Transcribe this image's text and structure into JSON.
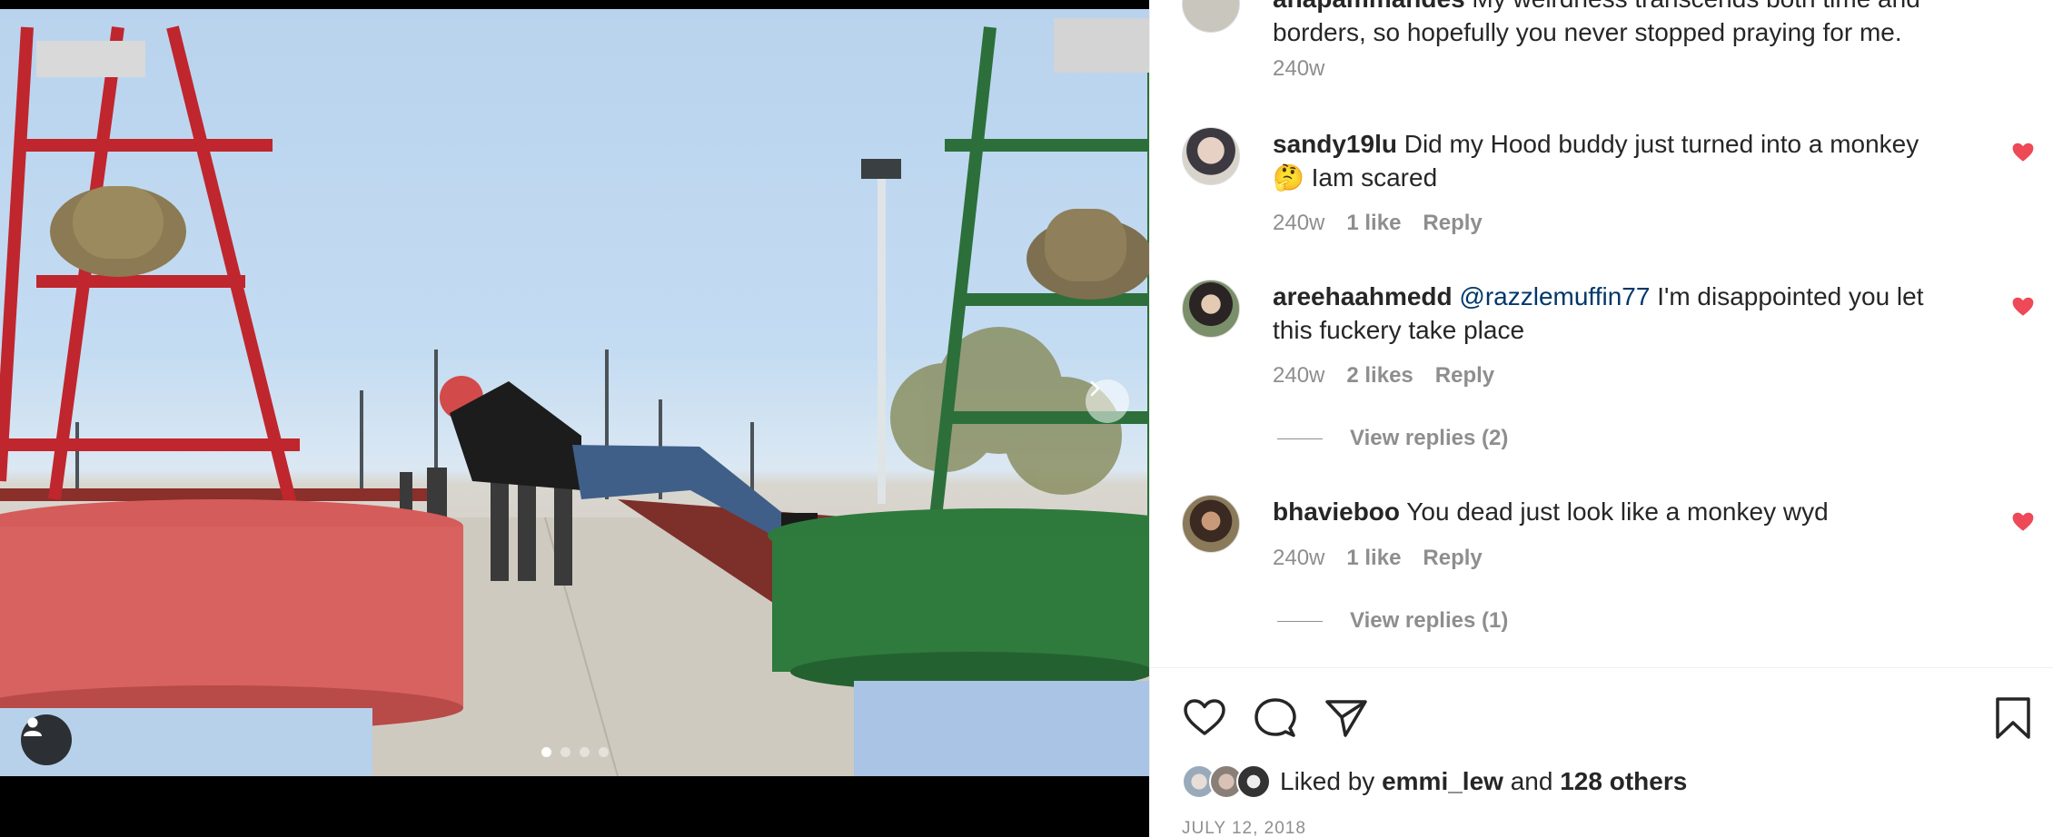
{
  "comments": [
    {
      "username": "anapammandes",
      "text": "My weirdness transcends both time and borders, so hopefully you never stopped praying for me.",
      "line1_tail": "My weirdness transcends both time and",
      "line2": "borders, so hopefully you never stopped praying for me.",
      "time": "240w"
    },
    {
      "username": "sandy19lu",
      "line1_tail": "Did my Hood buddy just turned into a monkey",
      "line2": "🤔 Iam scared",
      "time": "240w",
      "likes": "1 like",
      "reply": "Reply"
    },
    {
      "username": "areehaahmedd",
      "mention": "@razzlemuffin77",
      "line1_tail": "I'm disappointed you let",
      "line2": "this fuckery take place",
      "time": "240w",
      "likes": "2 likes",
      "reply": "Reply",
      "view_replies": "View replies (2)"
    },
    {
      "username": "bhavieboo",
      "line1_tail": "You dead just look like a monkey wyd",
      "time": "240w",
      "likes": "1 like",
      "reply": "Reply",
      "view_replies": "View replies (1)"
    }
  ],
  "liked_by": {
    "prefix": "Liked by",
    "user": "emmi_lew",
    "and": "and",
    "others": "128 others"
  },
  "post_date": "JULY 12, 2018",
  "carousel": {
    "count": 4,
    "active_index": 0
  },
  "colors": {
    "like_red": "#ed4956",
    "mention_blue": "#00376b",
    "meta_gray": "#8e8e8e",
    "text": "#262626"
  },
  "icons": [
    "next-arrow-icon",
    "user-tag-icon",
    "heart-icon",
    "comment-icon",
    "share-icon",
    "bookmark-icon",
    "heart-filled-icon"
  ]
}
